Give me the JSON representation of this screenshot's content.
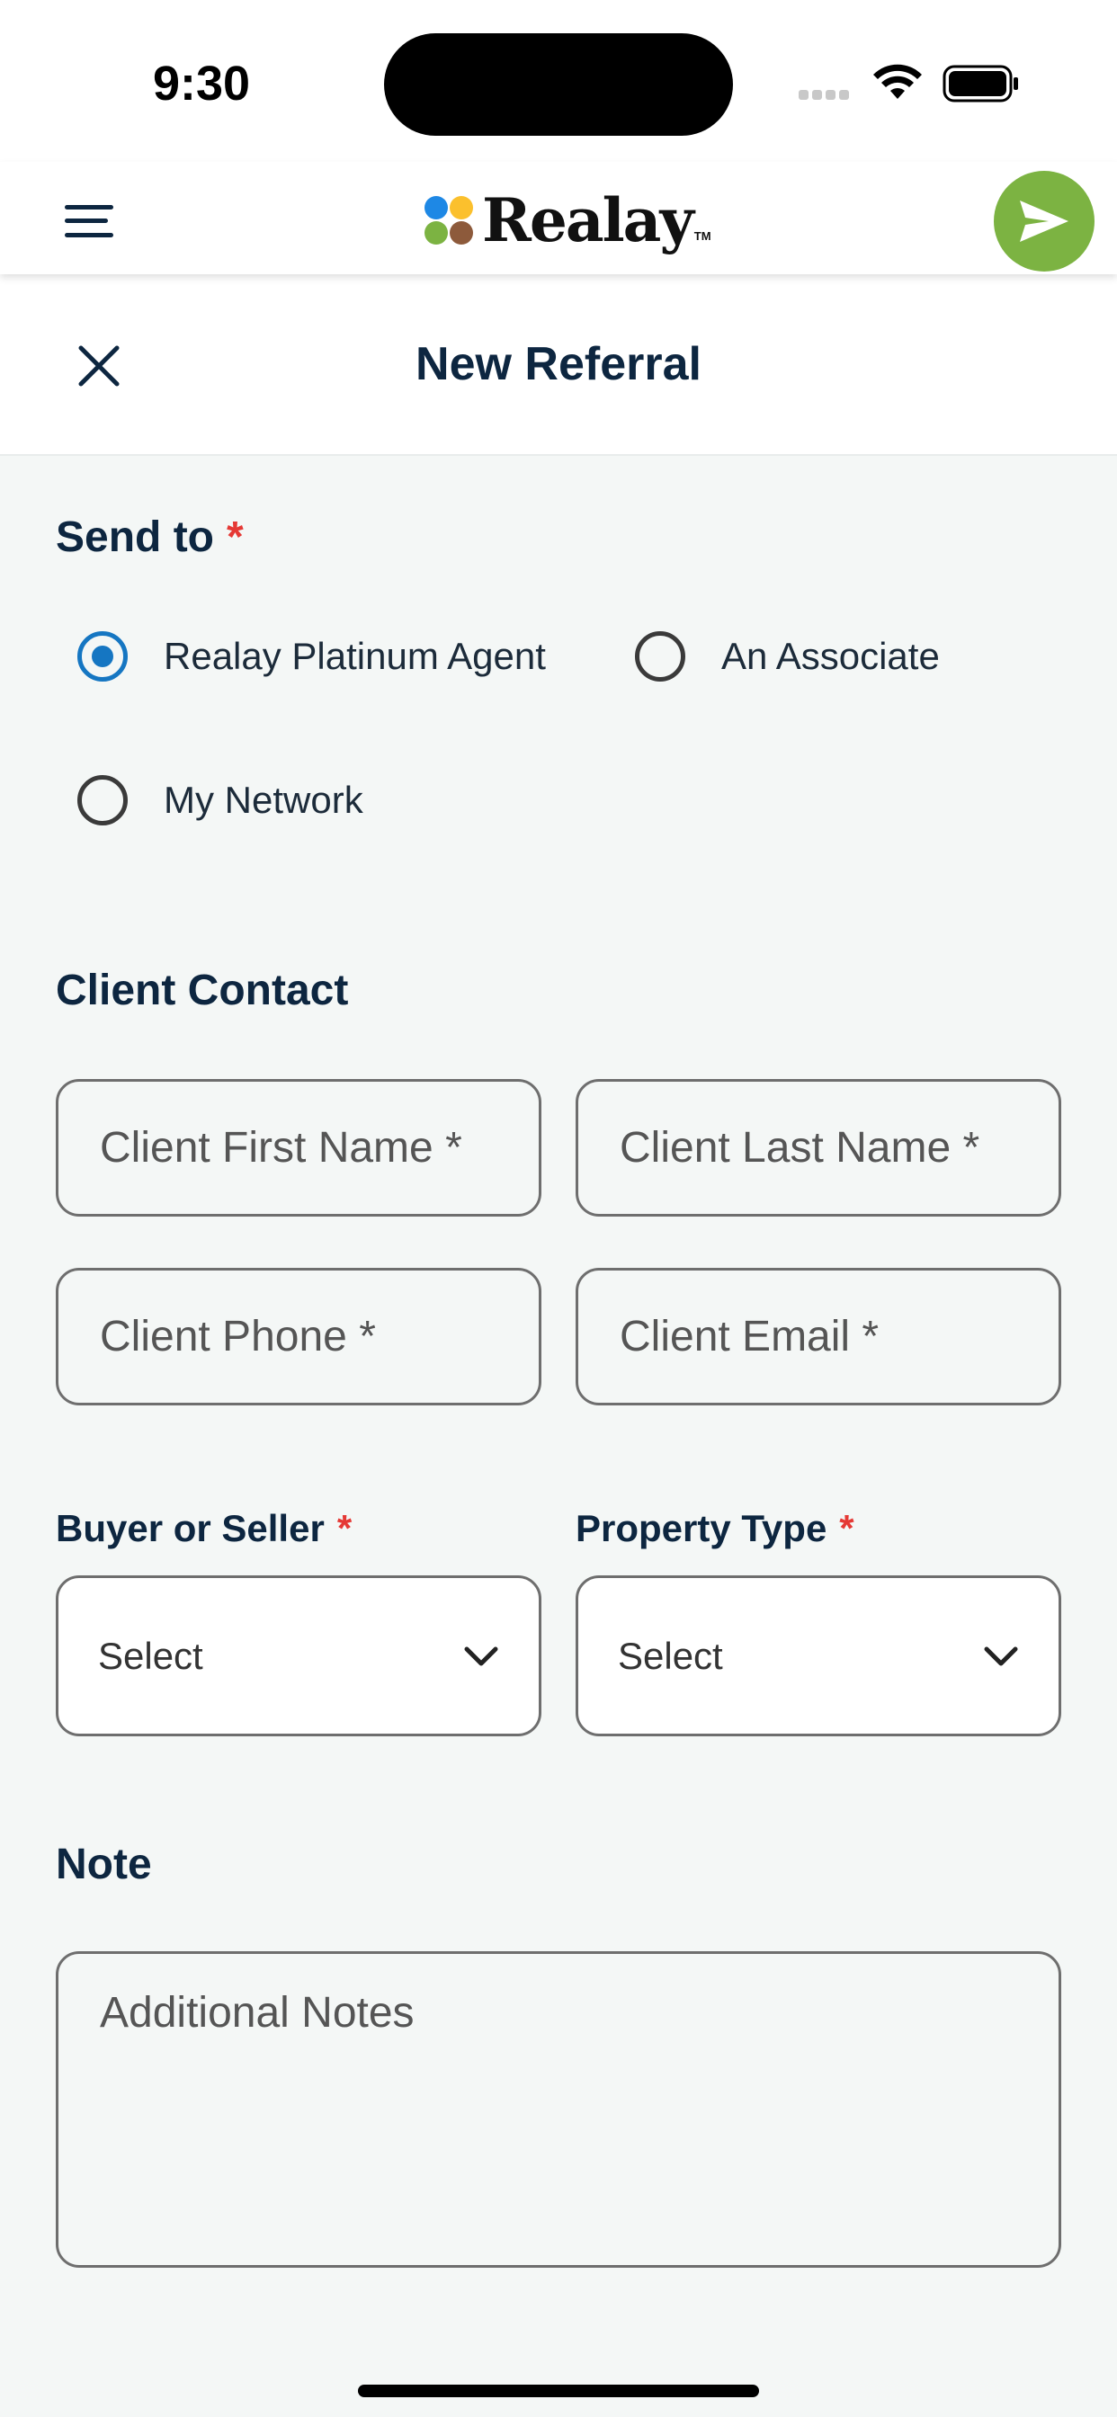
{
  "status_bar": {
    "time": "9:30"
  },
  "header": {
    "logo_text": "Realay",
    "logo_tm": "TM",
    "logo_colors": [
      "#1e88e5",
      "#fbc02d",
      "#7cb342",
      "#8d5a3b"
    ],
    "accent_color": "#7cb342"
  },
  "page": {
    "title": "New Referral"
  },
  "send_to": {
    "title": "Send to",
    "required_mark": "*",
    "options": [
      {
        "label": "Realay Platinum Agent",
        "selected": true
      },
      {
        "label": "An Associate",
        "selected": false
      },
      {
        "label": "My Network",
        "selected": false
      }
    ]
  },
  "client_contact": {
    "title": "Client Contact",
    "first_name_placeholder": "Client First Name *",
    "last_name_placeholder": "Client Last Name *",
    "phone_placeholder": "Client Phone *",
    "email_placeholder": "Client Email *"
  },
  "buyer_seller": {
    "label": "Buyer or Seller",
    "required_mark": "*",
    "value": "Select"
  },
  "property_type": {
    "label": "Property Type",
    "required_mark": "*",
    "value": "Select"
  },
  "note": {
    "title": "Note",
    "placeholder": "Additional Notes"
  }
}
